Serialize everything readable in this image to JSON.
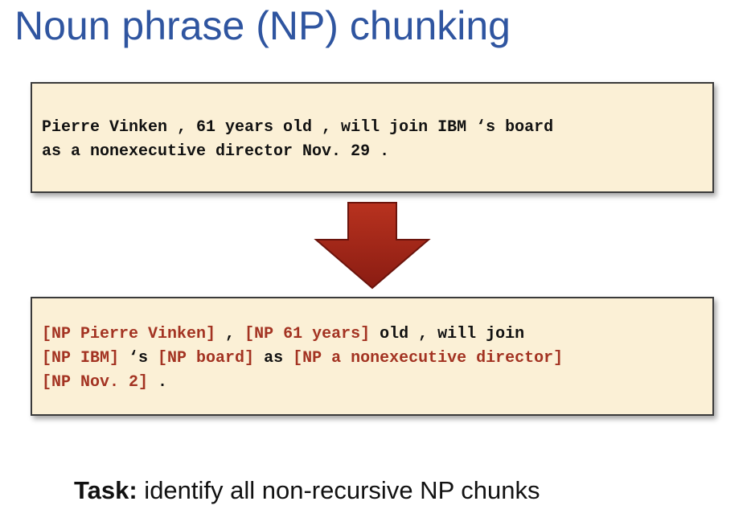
{
  "title": "Noun phrase (NP) chunking",
  "input_box": {
    "line1": "Pierre Vinken , 61 years old , will join IBM ‘s board",
    "line2": "as a nonexecutive director Nov. 29 ."
  },
  "arrow": {
    "icon": "down-arrow-icon",
    "color": "#a0241a"
  },
  "output_box": {
    "line1": [
      {
        "text": "[NP Pierre Vinken]",
        "np": true
      },
      {
        "text": " , ",
        "np": false
      },
      {
        "text": "[NP 61 years]",
        "np": true
      },
      {
        "text": " old , will join",
        "np": false
      }
    ],
    "line2": [
      {
        "text": "[NP IBM]",
        "np": true
      },
      {
        "text": " ‘s ",
        "np": false
      },
      {
        "text": "[NP board]",
        "np": true
      },
      {
        "text": " as ",
        "np": false
      },
      {
        "text": "[NP a nonexecutive director]",
        "np": true
      }
    ],
    "line3": [
      {
        "text": "[NP Nov. 2]",
        "np": true
      },
      {
        "text": " .",
        "np": false
      }
    ]
  },
  "task": {
    "label": "Task:",
    "text": " identify all non-recursive NP chunks"
  },
  "colors": {
    "title": "#2f55a0",
    "np_chunk": "#a33322",
    "box_fill": "#fbf0d6"
  }
}
